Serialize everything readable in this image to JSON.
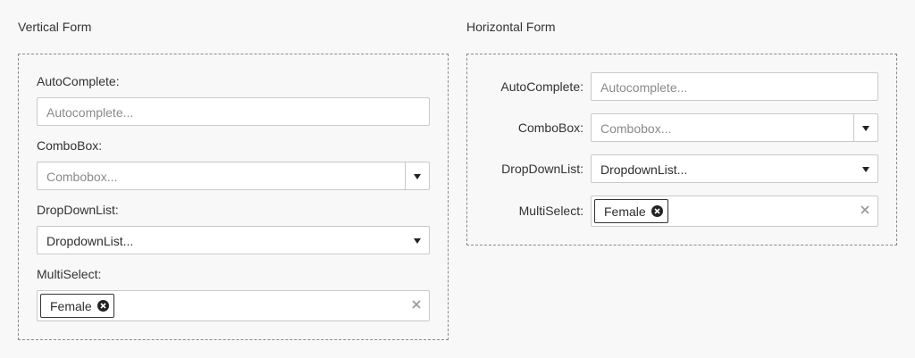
{
  "vertical": {
    "title": "Vertical Form",
    "autocomplete": {
      "label": "AutoComplete:",
      "placeholder": "Autocomplete..."
    },
    "combobox": {
      "label": "ComboBox:",
      "placeholder": "Combobox..."
    },
    "dropdownlist": {
      "label": "DropDownList:",
      "value": "DropdownList..."
    },
    "multiselect": {
      "label": "MultiSelect:",
      "chip": "Female"
    }
  },
  "horizontal": {
    "title": "Horizontal Form",
    "autocomplete": {
      "label": "AutoComplete:",
      "placeholder": "Autocomplete..."
    },
    "combobox": {
      "label": "ComboBox:",
      "placeholder": "Combobox..."
    },
    "dropdownlist": {
      "label": "DropDownList:",
      "value": "DropdownList..."
    },
    "multiselect": {
      "label": "MultiSelect:",
      "chip": "Female"
    }
  },
  "icons": {
    "dropdown": "caret-down-icon",
    "chip_remove": "circle-x-icon",
    "clear": "x-icon"
  }
}
